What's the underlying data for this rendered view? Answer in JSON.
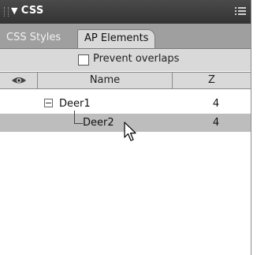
{
  "panel": {
    "title": "CSS",
    "title_arrow": "▼",
    "tabs": [
      {
        "label": "CSS Styles",
        "active": false
      },
      {
        "label": "AP Elements",
        "active": true
      }
    ],
    "prevent_overlaps": {
      "label": "Prevent overlaps",
      "checked": false
    }
  },
  "table": {
    "columns": {
      "visibility": "eye-icon",
      "name": "Name",
      "z": "Z"
    },
    "rows": [
      {
        "name": "Deer1",
        "z": "4",
        "expanded": true,
        "selected": false
      },
      {
        "name": "Deer2",
        "z": "4",
        "expanded": false,
        "selected": true
      }
    ]
  },
  "colors": {
    "title_bar": "#3c3c3c",
    "tab_row": "#9f9f9f",
    "active_tab": "#d9d9d9",
    "selected_row": "#bdbdbd"
  },
  "icons": {
    "panel_options": "panel-options-icon",
    "cursor": "mouse-pointer-icon"
  }
}
